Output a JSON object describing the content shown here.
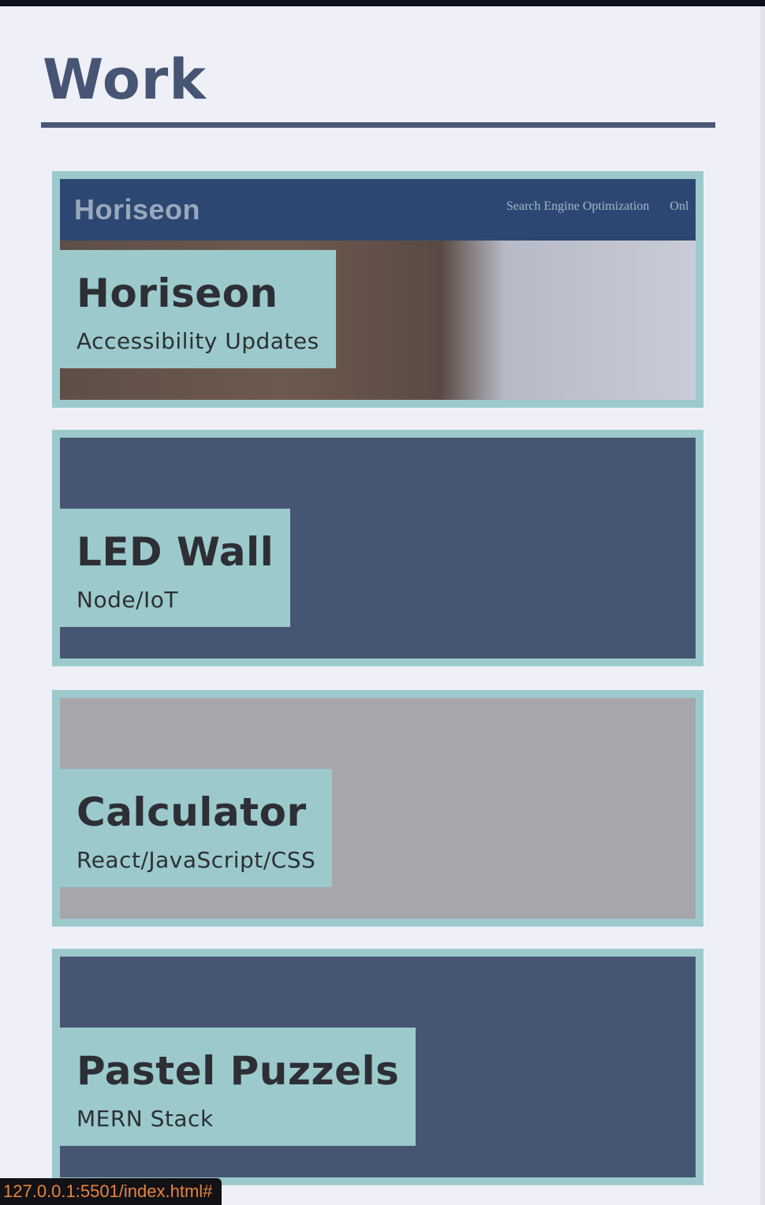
{
  "section": {
    "title": "Work"
  },
  "projects": [
    {
      "title": "Horiseon",
      "subtitle": "Accessibility Updates",
      "preview": {
        "logo": "Horiseon",
        "nav": [
          "Search Engine Optimization",
          "Onl"
        ]
      }
    },
    {
      "title": "LED Wall",
      "subtitle": "Node/IoT",
      "background": "#465573"
    },
    {
      "title": "Calculator",
      "subtitle": "React/JavaScript/CSS",
      "background": "#a6a6ab"
    },
    {
      "title": "Pastel Puzzels",
      "subtitle": "MERN Stack",
      "background": "#465573"
    }
  ],
  "status_bar": {
    "url": "127.0.0.1:5501/index.html#"
  },
  "colors": {
    "page_bg": "#efeff8",
    "heading": "#465574",
    "card_border": "#9ccacc",
    "label_text": "#2d2f35",
    "status_text": "#e8843a"
  }
}
